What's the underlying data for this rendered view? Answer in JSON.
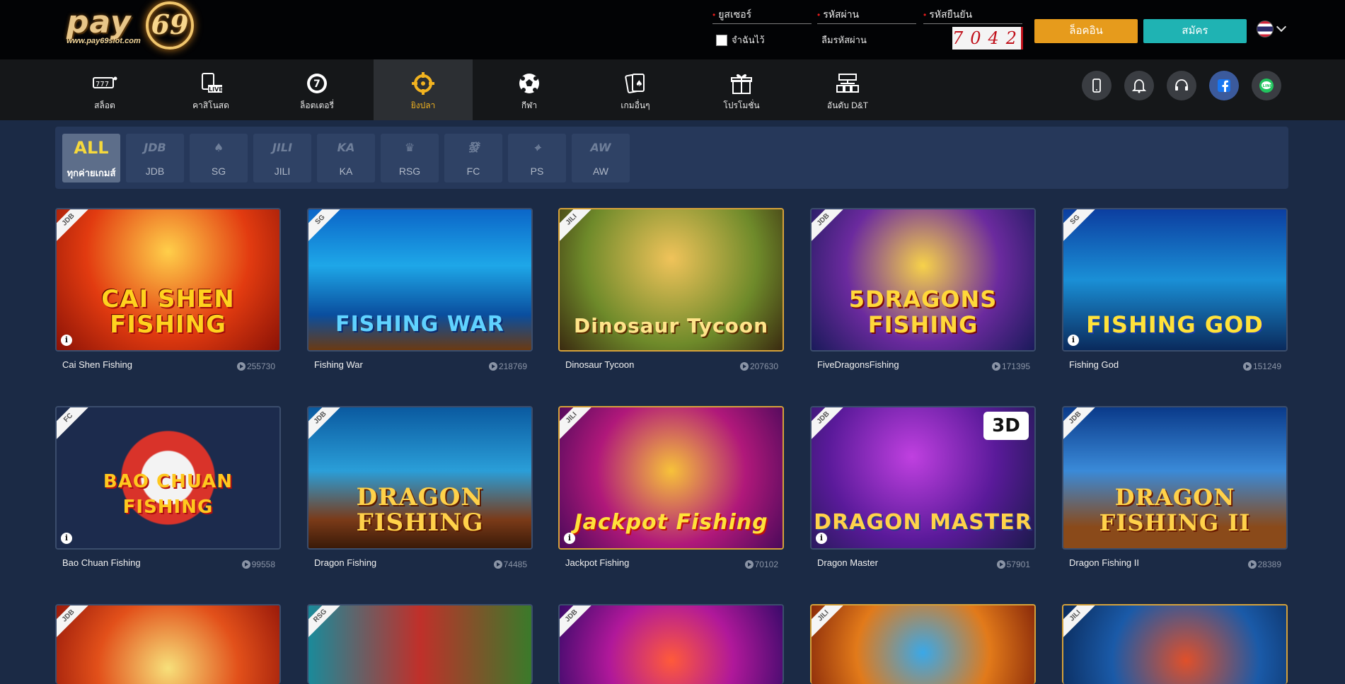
{
  "header": {
    "logo_text": "pay",
    "logo_number": "69",
    "logo_site": "www.pay69slot.com",
    "username_label": "ยูสเซอร์",
    "password_label": "รหัสผ่าน",
    "captcha_label": "รหัสยืนยัน",
    "remember_label": "จำฉันไว้",
    "forgot_label": "ลืมรหัสผ่าน",
    "captcha_code": "7042",
    "login_button": "ล็อคอิน",
    "register_button": "สมัคร"
  },
  "nav": {
    "items": [
      {
        "label": "สล็อต",
        "icon": "slot-icon"
      },
      {
        "label": "คาสิโนสด",
        "icon": "live-casino-icon"
      },
      {
        "label": "ล็อตเตอรี่",
        "icon": "lottery-icon"
      },
      {
        "label": "ยิงปลา",
        "icon": "fishing-target-icon",
        "active": true
      },
      {
        "label": "กีฬา",
        "icon": "soccer-ball-icon"
      },
      {
        "label": "เกมอื่นๆ",
        "icon": "cards-icon"
      },
      {
        "label": "โปรโมชั่น",
        "icon": "gift-icon"
      },
      {
        "label": "อันดับ D&T",
        "icon": "ranking-icon"
      }
    ],
    "quick_icons": [
      "mobile-icon",
      "bell-icon",
      "headset-icon",
      "facebook-icon",
      "line-icon"
    ]
  },
  "providers": [
    {
      "logo": "ALL",
      "label": "ทุกค่ายเกมส์",
      "active": true
    },
    {
      "logo": "JDB",
      "label": "JDB"
    },
    {
      "logo": "♠",
      "label": "SG"
    },
    {
      "logo": "JILI",
      "label": "JILI"
    },
    {
      "logo": "KA",
      "label": "KA"
    },
    {
      "logo": "♛",
      "label": "RSG"
    },
    {
      "logo": "發",
      "label": "FC"
    },
    {
      "logo": "⌖",
      "label": "PS"
    },
    {
      "logo": "AW",
      "label": "AW"
    }
  ],
  "games": [
    {
      "name": "Cai Shen Fishing",
      "plays": "255730",
      "provider": "JDB",
      "art": "CAI SHEN FISHING"
    },
    {
      "name": "Fishing War",
      "plays": "218769",
      "provider": "SG",
      "art": "FISHING WAR"
    },
    {
      "name": "Dinosaur Tycoon",
      "plays": "207630",
      "provider": "JILI",
      "art": "Dinosaur Tycoon"
    },
    {
      "name": "FiveDragonsFishing",
      "plays": "171395",
      "provider": "JDB",
      "art": "5DRAGONS FISHING"
    },
    {
      "name": "Fishing God",
      "plays": "151249",
      "provider": "SG",
      "art": "FISHING GOD"
    },
    {
      "name": "Bao Chuan Fishing",
      "plays": "99558",
      "provider": "FC",
      "art": "BAO CHUAN FISHING"
    },
    {
      "name": "Dragon Fishing",
      "plays": "74485",
      "provider": "JDB",
      "art": "DRAGON FISHING"
    },
    {
      "name": "Jackpot Fishing",
      "plays": "70102",
      "provider": "JILI",
      "art": "Jackpot Fishing"
    },
    {
      "name": "Dragon Master",
      "plays": "57901",
      "provider": "JDB",
      "art": "DRAGON MASTER"
    },
    {
      "name": "Dragon Fishing II",
      "plays": "28389",
      "provider": "JDB",
      "art": "DRAGON FISHING II"
    },
    {
      "name": "",
      "plays": "",
      "provider": "JDB",
      "art": ""
    },
    {
      "name": "",
      "plays": "",
      "provider": "RSG",
      "art": ""
    },
    {
      "name": "",
      "plays": "",
      "provider": "JDB",
      "art": ""
    },
    {
      "name": "",
      "plays": "",
      "provider": "JILI",
      "art": ""
    },
    {
      "name": "",
      "plays": "",
      "provider": "JILI",
      "art": ""
    }
  ],
  "colors": {
    "accent_gold": "#f2b320",
    "login_orange": "#e69b1c",
    "register_teal": "#1fb3b3",
    "page_bg": "#1b2a45"
  }
}
